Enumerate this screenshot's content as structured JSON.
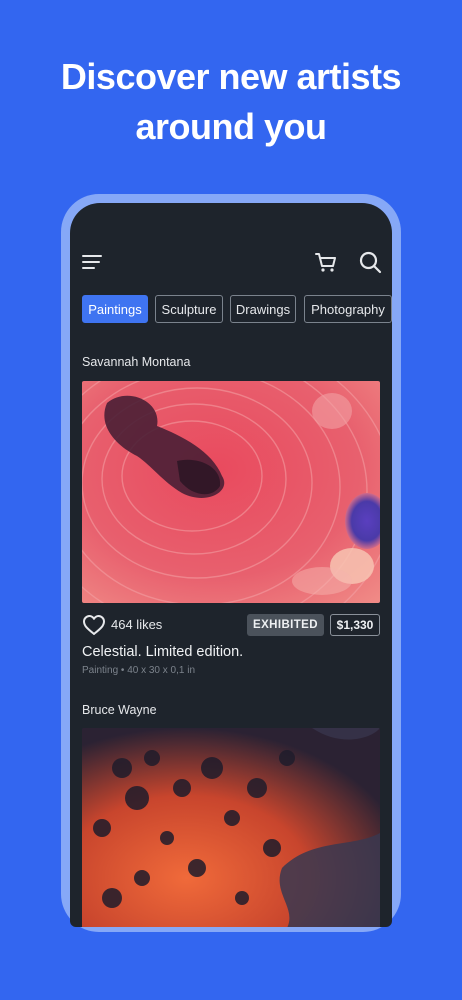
{
  "headline": {
    "line1": "Discover new artists",
    "line2": "around you"
  },
  "app_bar": {
    "menu_icon": "hamburger-menu-icon",
    "cart_icon": "shopping-cart-icon",
    "search_icon": "search-icon"
  },
  "categories": [
    {
      "label": "Paintings",
      "active": true
    },
    {
      "label": "Sculpture",
      "active": false
    },
    {
      "label": "Drawings",
      "active": false
    },
    {
      "label": "Photography",
      "active": false
    }
  ],
  "feed": [
    {
      "artist": "Savannah Montana",
      "likes": "464 likes",
      "badge": "EXHIBITED",
      "price": "$1,330",
      "title": "Celestial. Limited edition.",
      "meta": "Painting • 40 x 30 x 0,1 in"
    },
    {
      "artist": "Bruce Wayne"
    }
  ],
  "colors": {
    "background": "#3366f0",
    "screen": "#1e242c",
    "accent": "#3f74f1",
    "frame": "#86a8f7"
  }
}
